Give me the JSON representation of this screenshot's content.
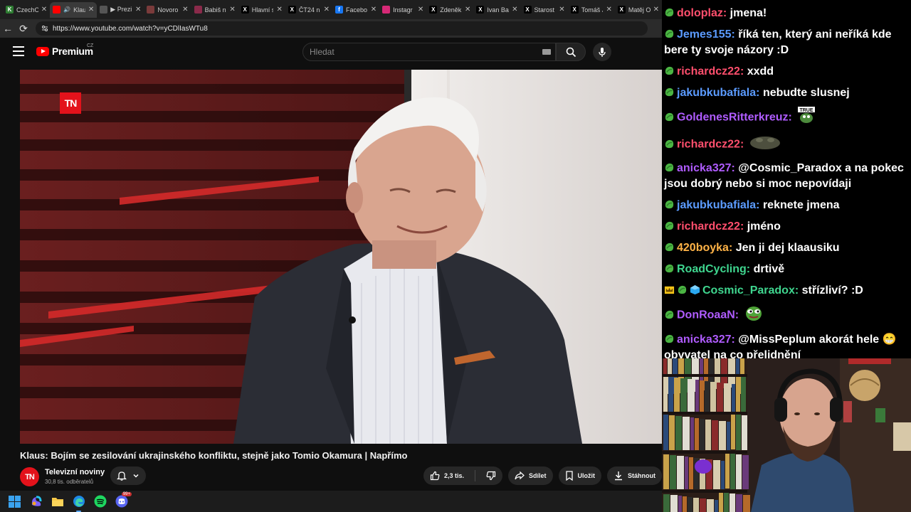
{
  "browser": {
    "tabs": [
      {
        "title": "CzechO",
        "favicon": "czech-icon",
        "color": "#2e7d32",
        "letter": "K"
      },
      {
        "title": "Klaus",
        "favicon": "youtube-icon",
        "color": "#ff0000",
        "letter": "",
        "active": true
      },
      {
        "title": "▶ Prezi",
        "favicon": "generic-icon",
        "color": "#555555",
        "letter": ""
      },
      {
        "title": "Novoro",
        "favicon": "web-icon",
        "color": "#7a3b3b",
        "letter": ""
      },
      {
        "title": "Babiš n",
        "favicon": "web-icon",
        "color": "#8a2a4a",
        "letter": ""
      },
      {
        "title": "Hlavní s",
        "favicon": "x-icon",
        "color": "#000000",
        "letter": "X"
      },
      {
        "title": "ČT24 n",
        "favicon": "x-icon",
        "color": "#000000",
        "letter": "X"
      },
      {
        "title": "Facebo",
        "favicon": "facebook-icon",
        "color": "#1877f2",
        "letter": "f"
      },
      {
        "title": "Instagr",
        "favicon": "instagram-icon",
        "color": "#d62976",
        "letter": ""
      },
      {
        "title": "Zdeněk",
        "favicon": "x-icon",
        "color": "#000000",
        "letter": "X"
      },
      {
        "title": "Ivan Ba",
        "favicon": "x-icon",
        "color": "#000000",
        "letter": "X"
      },
      {
        "title": "Starost",
        "favicon": "x-icon",
        "color": "#000000",
        "letter": "X"
      },
      {
        "title": "Tomáš J",
        "favicon": "x-icon",
        "color": "#000000",
        "letter": "X"
      },
      {
        "title": "Matěj O",
        "favicon": "x-icon",
        "color": "#000000",
        "letter": "X"
      }
    ],
    "url": "https://www.youtube.com/watch?v=yCDlIasWTu8"
  },
  "youtube": {
    "logo_text": "Premium",
    "logo_region": "CZ",
    "search_placeholder": "Hledat",
    "video_badge": "TN",
    "video_title": "Klaus: Bojím se zesilování ukrajinského konfliktu, stejně jako Tomio Okamura | Napřímo",
    "channel_avatar": "TN",
    "channel_name": "Televizní noviny",
    "channel_subs": "30,8 tis. odběratelů",
    "like_count": "2,3 tis.",
    "share_label": "Sdílet",
    "save_label": "Uložit",
    "download_label": "Stáhnout"
  },
  "taskbar": {
    "discord_badge": "99+"
  },
  "chat": {
    "messages": [
      {
        "user": "doloplaz",
        "color": "#ff4f6d",
        "text": "jmena!"
      },
      {
        "user": "Jemes155",
        "color": "#5b9bff",
        "text": "říká ten, který ani neříká kde bere ty svoje názory :D"
      },
      {
        "user": "richardcz22",
        "color": "#ff4f6d",
        "text": "xxdd"
      },
      {
        "user": "jakubkubafiala",
        "color": "#5b9bff",
        "text": "nebudte slusnej"
      },
      {
        "user": "GoldenesRitterkreuz",
        "color": "#b05cff",
        "text": "",
        "emote": "true-emote",
        "emote_label": "TRUE"
      },
      {
        "user": "richardcz22",
        "color": "#ff4f6d",
        "text": "",
        "emote": "frog-emote"
      },
      {
        "user": "anicka327",
        "color": "#b05cff",
        "text": "@Cosmic_Paradox a na pokec jsou dobrý nebo si moc nepovídaji"
      },
      {
        "user": "jakubkubafiala",
        "color": "#5b9bff",
        "text": "reknete jmena"
      },
      {
        "user": "richardcz22",
        "color": "#ff4f6d",
        "text": "jméno"
      },
      {
        "user": "420boyka",
        "color": "#ffb347",
        "text": "Jen ji dej klaausiku"
      },
      {
        "user": "RoadCycling",
        "color": "#3fd68f",
        "text": "drtivě"
      },
      {
        "user": "Cosmic_Paradox",
        "color": "#3fd68f",
        "text": "střízliví? :D",
        "extra_badges": true
      },
      {
        "user": "DonRoaaN",
        "color": "#b05cff",
        "text": "",
        "emote": "pepe-emote"
      },
      {
        "user": "anicka327",
        "color": "#b05cff",
        "text": "@MissPeplum akorát hele 😁 obyvatel na co přelidnění"
      }
    ]
  }
}
